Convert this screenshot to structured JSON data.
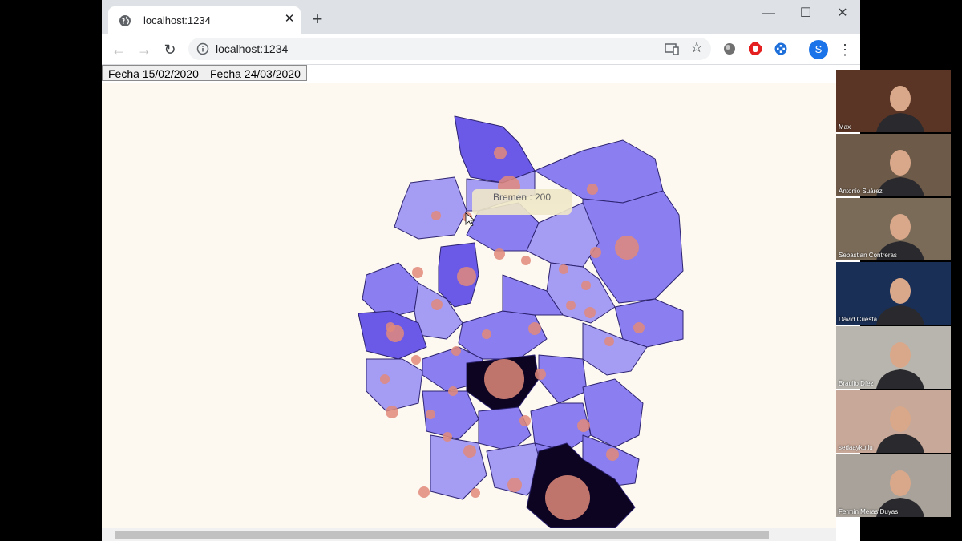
{
  "browser": {
    "tab_title": "localhost:1234",
    "tab_close": "✕",
    "new_tab": "+",
    "window_controls": {
      "minimize": "—",
      "maximize": "☐",
      "close": "✕"
    },
    "toolbar": {
      "back": "←",
      "forward": "→",
      "reload": "↻",
      "star": "☆",
      "menu": "⋮"
    },
    "url": "localhost:1234",
    "profile_initial": "S"
  },
  "page": {
    "buttons": [
      "Fecha 15/02/2020",
      "Fecha 24/03/2020"
    ],
    "tooltip": "Bremen : 200"
  },
  "colors": {
    "state_light": "#a59cf4",
    "state_medium": "#8a7ef0",
    "state_strong": "#6b5ae8",
    "state_darkest": "#0c0420",
    "state_border": "#2d2370",
    "bubble": "#e08a7a"
  },
  "participants": [
    {
      "name": "Max",
      "bg": "#5a3525"
    },
    {
      "name": "Antonio Suárez",
      "bg": "#6e5a48"
    },
    {
      "name": "Sebastian Contreras",
      "bg": "#7a6a58"
    },
    {
      "name": "David Cuesta",
      "bg": "#1a2f55"
    },
    {
      "name": "Braulio Díez",
      "bg": "#b8b5ae"
    },
    {
      "name": "sedaaykutlu",
      "bg": "#c8a898"
    },
    {
      "name": "Fermin Meras Duyas",
      "bg": "#a8a29a"
    }
  ]
}
